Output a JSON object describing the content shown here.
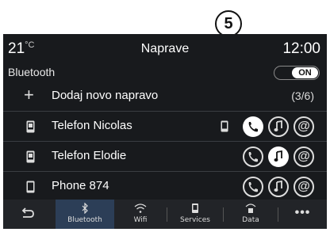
{
  "callout": "5",
  "status": {
    "temperature": "21",
    "temp_unit": "°C",
    "title": "Naprave",
    "clock": "12:00"
  },
  "bluetooth_setting": {
    "label": "Bluetooth",
    "toggle_state": "ON"
  },
  "add_device": {
    "label": "Dodaj novo napravo",
    "count": "(3/6)"
  },
  "devices": [
    {
      "name": "Telefon Nicolas"
    },
    {
      "name": "Telefon Elodie"
    },
    {
      "name": "Phone 874"
    }
  ],
  "navbar": {
    "items": [
      {
        "label": "",
        "icon": "back-arrow-icon"
      },
      {
        "label": "Bluetooth",
        "icon": "bluetooth-icon"
      },
      {
        "label": "Wifi",
        "icon": "wifi-icon"
      },
      {
        "label": "Services",
        "icon": "services-icon"
      },
      {
        "label": "Data",
        "icon": "data-icon"
      },
      {
        "label": "",
        "icon": "more-icon"
      }
    ]
  },
  "colors": {
    "background": "#181a1d",
    "active_tab": "#2c3e57",
    "accent": "#ffffff"
  }
}
